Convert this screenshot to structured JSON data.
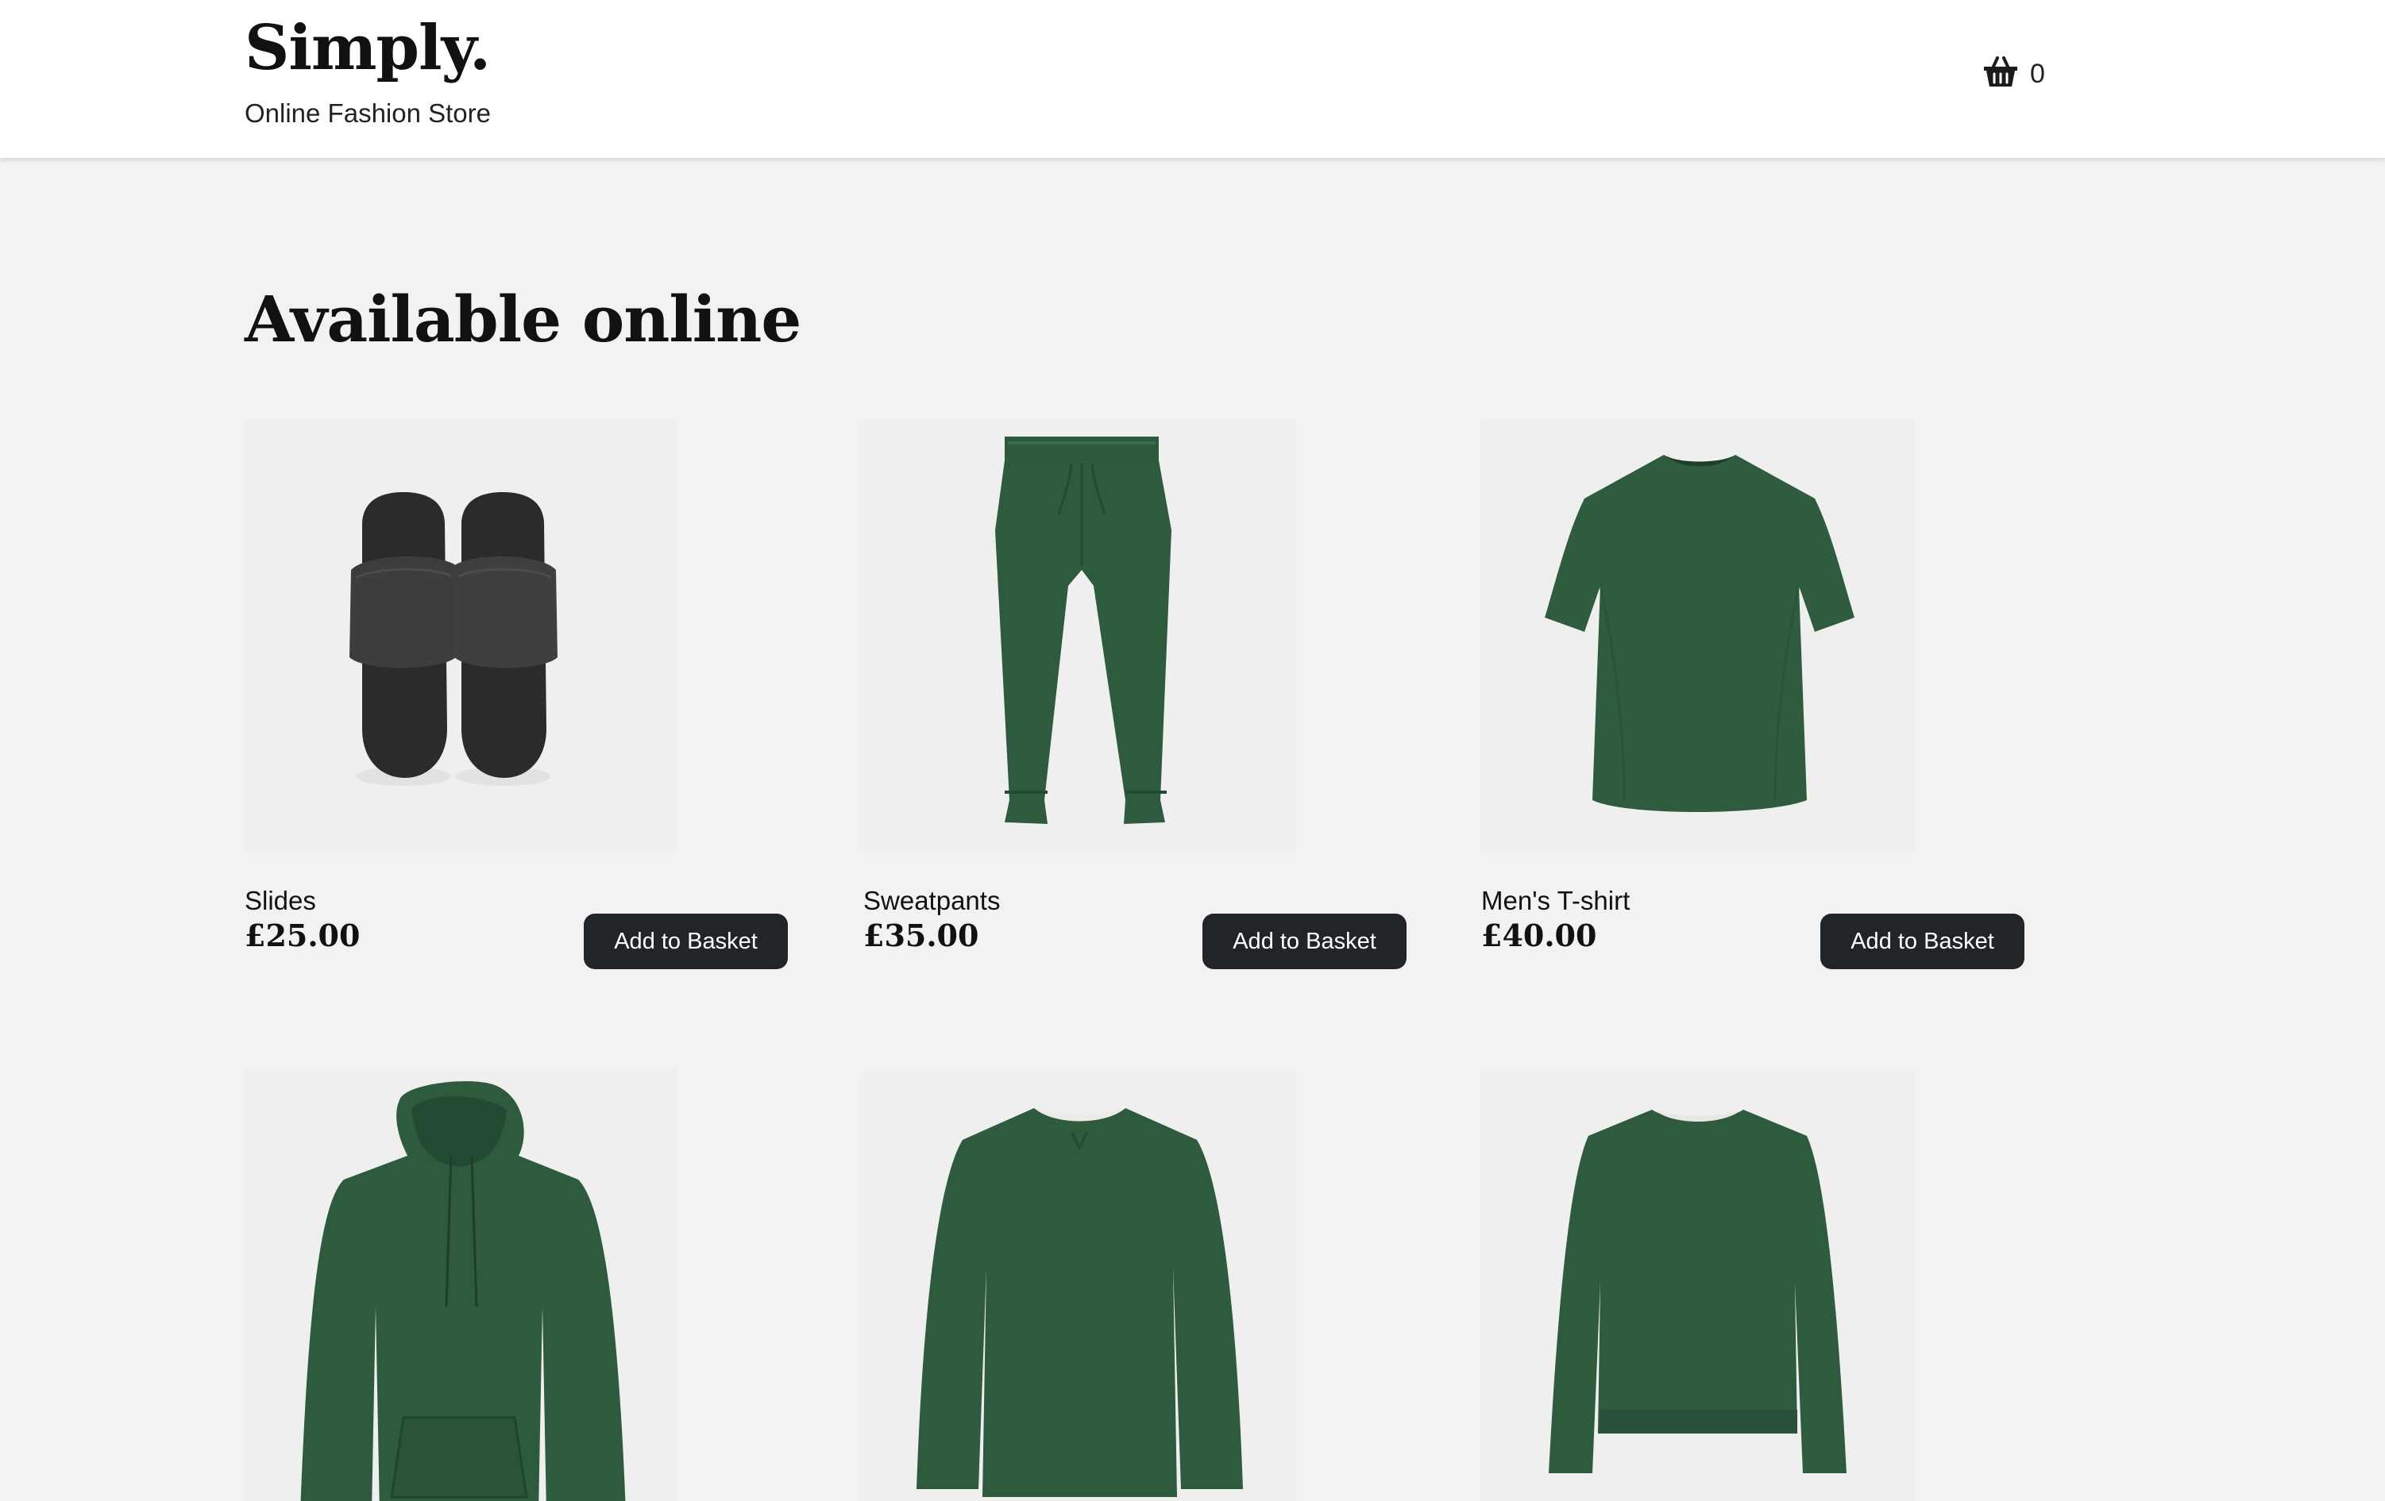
{
  "header": {
    "brand_title": "Simply.",
    "brand_subtitle": "Online Fashion Store",
    "basket_icon": "basket-icon",
    "basket_count": "0"
  },
  "main": {
    "heading": "Available online",
    "products": [
      {
        "name": "Slides",
        "price": "£25.00",
        "button_label": "Add to Basket",
        "image": "black-slides-image"
      },
      {
        "name": "Sweatpants",
        "price": "£35.00",
        "button_label": "Add to Basket",
        "image": "green-sweatpants-image"
      },
      {
        "name": "Men's T-shirt",
        "price": "£40.00",
        "button_label": "Add to Basket",
        "image": "green-tshirt-image"
      },
      {
        "image": "green-hoodie-image"
      },
      {
        "image": "green-sweatshirt-image"
      },
      {
        "image": "green-womens-sweatshirt-image"
      }
    ]
  },
  "colors": {
    "page_background": "#f3f2f2",
    "header_background": "#ffffff",
    "button_background": "#212529",
    "button_text": "#ffffff",
    "product_green": "#2e5a3e",
    "slides_black": "#2a2c2b"
  }
}
